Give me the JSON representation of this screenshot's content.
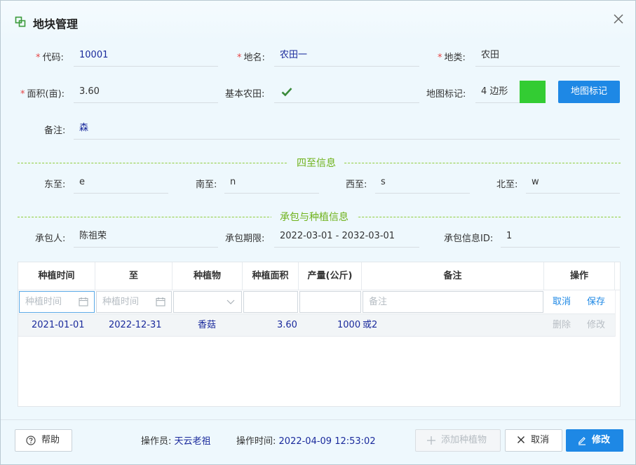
{
  "dialog": {
    "title": "地块管理",
    "title_icon": "copy-icon",
    "close_icon": "close-icon"
  },
  "form": {
    "code": {
      "label": "代码:",
      "value": "10001",
      "required": true
    },
    "name": {
      "label": "地名:",
      "value": "农田一",
      "required": true
    },
    "category": {
      "label": "地类:",
      "value": "农田",
      "required": true
    },
    "area": {
      "label": "面积(亩):",
      "value": "3.60",
      "required": true
    },
    "basic_farmland": {
      "label": "基本农田:",
      "checked": true,
      "icon": "checkmark-icon",
      "check_color": "#3a8a3a"
    },
    "map_mark": {
      "label": "地图标记:",
      "value": "4 边形",
      "swatch_color": "#33cc33",
      "button_label": "地图标记"
    },
    "remark": {
      "label": "备注:",
      "value": "森"
    }
  },
  "boundaries": {
    "section_title": "四至信息",
    "east": {
      "label": "东至:",
      "value": "e"
    },
    "south": {
      "label": "南至:",
      "value": "n"
    },
    "west": {
      "label": "西至:",
      "value": "s"
    },
    "north": {
      "label": "北至:",
      "value": "w"
    }
  },
  "contract": {
    "section_title": "承包与种植信息",
    "contractor": {
      "label": "承包人:",
      "value": "陈祖荣"
    },
    "period": {
      "label": "承包期限:",
      "value": "2022-03-01 - 2032-03-01"
    },
    "contract_id": {
      "label": "承包信息ID:",
      "value": "1"
    }
  },
  "planting_grid": {
    "columns": [
      "种植时间",
      "至",
      "种植物",
      "种植面积",
      "产量(公斤)",
      "备注",
      "操作"
    ],
    "edit_row": {
      "start_placeholder": "种植时间",
      "end_placeholder": "种植时间",
      "plant_value": "",
      "area_value": "",
      "yield_value": "",
      "remark_placeholder": "备注",
      "cancel_label": "取消",
      "save_label": "保存"
    },
    "rows": [
      {
        "start": "2021-01-01",
        "end": "2022-12-31",
        "plant": "香菇",
        "area": "3.60",
        "yield": "1000",
        "remark": "或2",
        "delete_label": "删除",
        "edit_label": "修改"
      }
    ]
  },
  "footer": {
    "help_label": "帮助",
    "operator_label": "操作员:",
    "operator_value": "天云老祖",
    "time_label": "操作时间:",
    "time_value": "2022-04-09 12:53:02",
    "add_plant_label": "添加种植物",
    "cancel_label": "取消",
    "modify_label": "修改"
  },
  "colors": {
    "accent": "#1e88e5",
    "section_title": "#6fb21b",
    "value_text": "#1a2a9c",
    "required": "#e64545"
  }
}
